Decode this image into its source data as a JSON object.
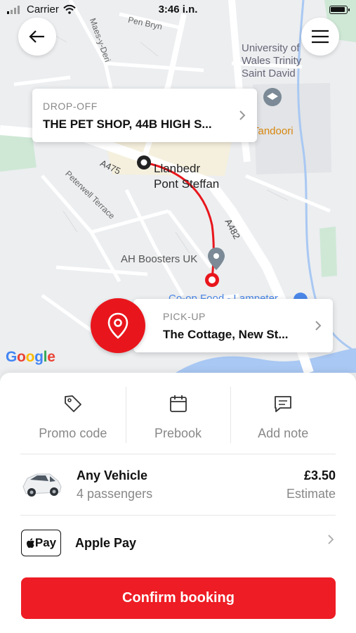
{
  "status_bar": {
    "carrier": "Carrier",
    "time": "3:46 i.n."
  },
  "map": {
    "labels": {
      "pen_bryn": "Pen Bryn",
      "maes_y_deri": "Maes-y-Deri",
      "university": "University of\nWales Trinity\nSaint David",
      "tandoori": "Tandoori",
      "a475": "A475",
      "town": "Llanbedr\nPont Steffan",
      "peterwell": "Peterwell Terrace",
      "a482": "A482",
      "ah_boosters": "AH Boosters UK",
      "co_op": "Co-op Food - Lampeter",
      "google": "Google"
    },
    "dropoff": {
      "caption": "DROP-OFF",
      "address": "THE PET SHOP, 44B HIGH S..."
    },
    "pickup": {
      "caption": "PICK-UP",
      "address": "The Cottage, New St..."
    }
  },
  "icons": {
    "back": "arrow-left-icon",
    "menu": "hamburger-menu-icon",
    "pin": "location-pin-icon"
  },
  "actions": [
    {
      "label": "Promo code",
      "icon": "tag-icon"
    },
    {
      "label": "Prebook",
      "icon": "calendar-icon"
    },
    {
      "label": "Add note",
      "icon": "message-icon"
    }
  ],
  "vehicle": {
    "name": "Any Vehicle",
    "passengers": "4 passengers",
    "price": "£3.50",
    "price_note": "Estimate"
  },
  "payment": {
    "badge": "Pay",
    "method": "Apple Pay"
  },
  "confirm": {
    "label": "Confirm booking"
  },
  "colors": {
    "accent": "#ee1c24",
    "route": "#e8161c"
  }
}
